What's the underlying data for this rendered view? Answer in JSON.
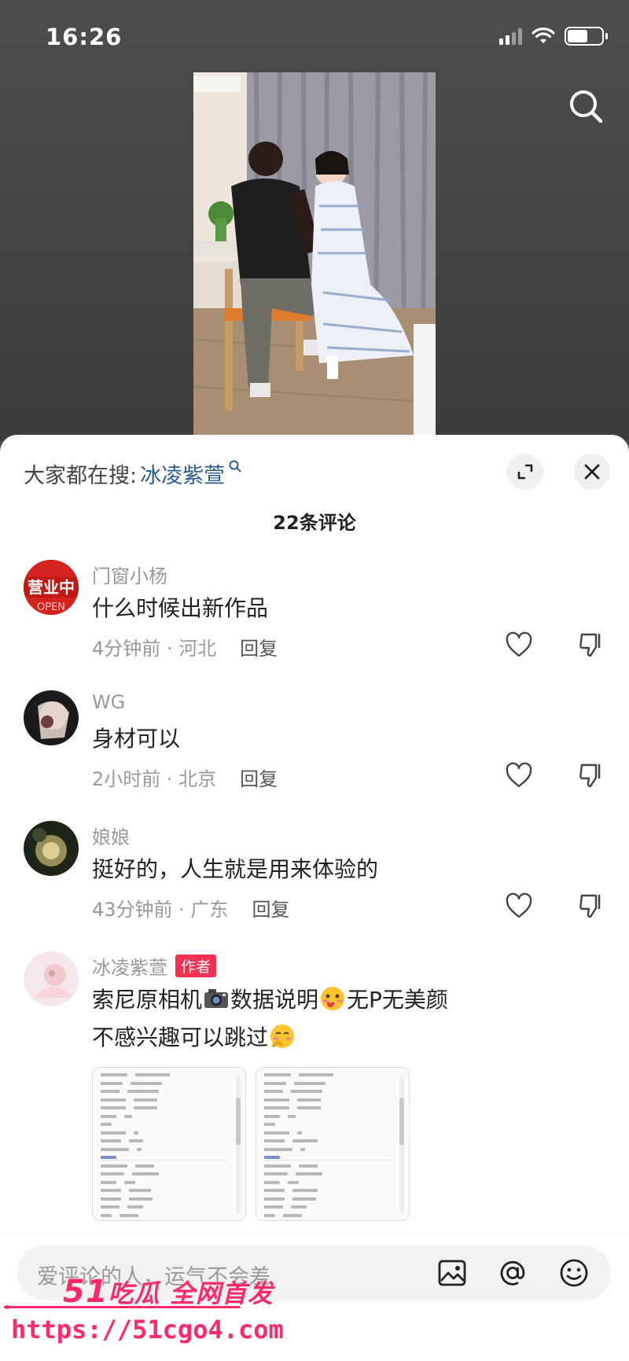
{
  "status": {
    "time": "16:26"
  },
  "sheet": {
    "hot_search_prefix": "大家都在搜:",
    "hot_search_keyword": "冰凌紫萱",
    "comment_count": "22条评论"
  },
  "comments": [
    {
      "name": "门窗小杨",
      "text": "什么时候出新作品",
      "time_loc": "4分钟前 · 河北",
      "reply": "回复"
    },
    {
      "name": "WG",
      "text": "身材可以",
      "time_loc": "2小时前 · 北京",
      "reply": "回复"
    },
    {
      "name": "娘娘",
      "text": "挺好的，人生就是用来体验的",
      "time_loc": "43分钟前 · 广东",
      "reply": "回复"
    },
    {
      "name": "冰凌紫萱",
      "badge": "作者",
      "text_line1_a": "索尼原相机",
      "text_line1_b": "数据说明",
      "text_line1_c": "无P无美颜",
      "text_line2": "不感兴趣可以跳过"
    }
  ],
  "input": {
    "placeholder": "爱评论的人，运气不会差"
  },
  "watermark": {
    "line1_num": "51",
    "line1_rest": "吃瓜 全网首发",
    "url": "https://51cgo4.com"
  },
  "icons": {
    "search": "search-icon",
    "expand": "expand-icon",
    "close": "close-icon",
    "like": "heart-icon",
    "dislike": "thumbs-down-icon",
    "image": "image-icon",
    "mention": "at-icon",
    "emoji": "smiley-icon"
  }
}
